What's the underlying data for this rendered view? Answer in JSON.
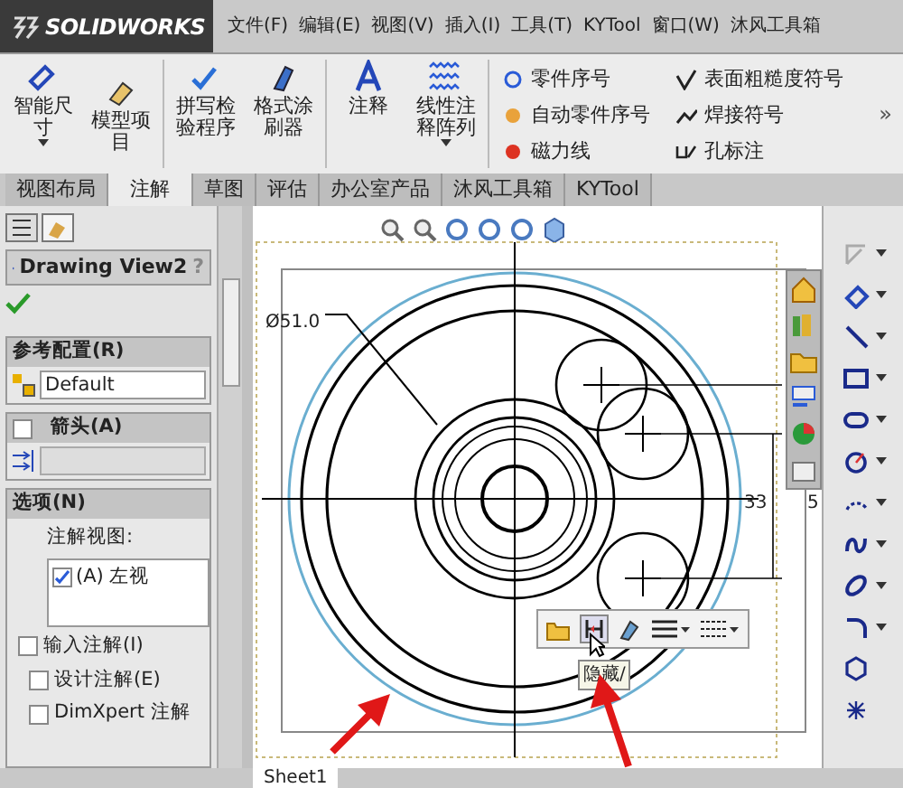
{
  "app": {
    "logo": "SOLIDWORKS"
  },
  "menu": [
    "文件(F)",
    "编辑(E)",
    "视图(V)",
    "插入(I)",
    "工具(T)",
    "KYTool",
    "窗口(W)",
    "沐风工具箱"
  ],
  "ribbon": {
    "large": [
      {
        "label": "智能尺寸",
        "dropdown": true
      },
      {
        "label": "模型项目",
        "dropdown": false
      },
      {
        "label": "拼写检验程序",
        "dropdown": false
      },
      {
        "label": "格式涂刷器",
        "dropdown": false
      },
      {
        "label": "注释",
        "dropdown": false
      },
      {
        "label": "线性注释阵列",
        "dropdown": true
      }
    ],
    "small": [
      "零件序号",
      "自动零件序号",
      "磁力线",
      "表面粗糙度符号",
      "焊接符号",
      "孔标注"
    ],
    "more": "»"
  },
  "tabs": [
    {
      "label": "视图布局",
      "selected": false
    },
    {
      "label": "注解",
      "selected": true
    },
    {
      "label": "草图",
      "selected": false
    },
    {
      "label": "评估",
      "selected": false
    },
    {
      "label": "办公室产品",
      "selected": false
    },
    {
      "label": "沐风工具箱",
      "selected": false
    },
    {
      "label": "KYTool",
      "selected": false
    }
  ],
  "property_manager": {
    "title": "Drawing View2",
    "help": "?",
    "reference_config": {
      "header": "参考配置(R)",
      "value": "Default"
    },
    "arrow": {
      "header": "箭头(A)",
      "checked": false
    },
    "options": {
      "header": "选项(N)",
      "list_label": "注解视图:",
      "views": [
        {
          "label": "(A) 左视",
          "checked": true
        }
      ],
      "items": [
        {
          "label": "输入注解(I)",
          "checked": false,
          "indented": false
        },
        {
          "label": "设计注解(E)",
          "checked": false,
          "indented": true
        },
        {
          "label": "DimXpert 注解",
          "checked": false,
          "indented": true
        }
      ]
    }
  },
  "drawing": {
    "diameter_label": "Ø51.0",
    "dim_33": "33",
    "dim_5": "5",
    "popup_tooltip": "隐藏/"
  },
  "sheet_tabs": [
    {
      "label": "Sheet1",
      "selected": true
    }
  ]
}
